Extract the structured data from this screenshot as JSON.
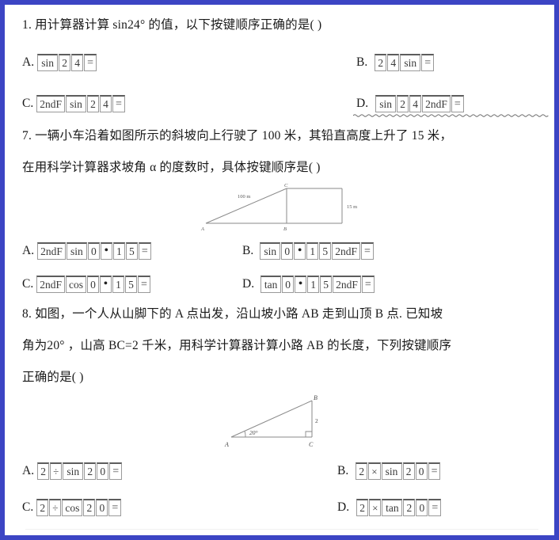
{
  "page": {
    "border_color": "#3c45c4",
    "background": "#ffffff",
    "text_color": "#1a1a1a",
    "key_border_color": "#9a9a9a"
  },
  "questions": [
    {
      "id": "q1",
      "number": "1.",
      "lines": [
        "1. 用计算器计算 sin24° 的值，以下按键顺序正确的是(      )"
      ],
      "options": [
        {
          "label": "A.",
          "keys": [
            "sin",
            "2",
            "4",
            "="
          ],
          "underlined": false
        },
        {
          "label": "B.",
          "keys": [
            "2",
            "4",
            "sin",
            "="
          ],
          "underlined": false
        },
        {
          "label": "C.",
          "keys": [
            "2ndF",
            "sin",
            "2",
            "4",
            "="
          ],
          "underlined": false
        },
        {
          "label": "D.",
          "keys": [
            "sin",
            "2",
            "4",
            "2ndF",
            "="
          ],
          "underlined": true
        }
      ]
    },
    {
      "id": "q7",
      "number": "7.",
      "lines": [
        "7. 一辆小车沿着如图所示的斜坡向上行驶了 100 米，其铅直高度上升了 15 米，",
        "在用科学计算器求坡角 α 的度数时，具体按键顺序是(          )"
      ],
      "figure": {
        "name": "slope-triangle-diagram",
        "labels": {
          "hypotenuse": "100 m",
          "vertical": "15 m",
          "vertex_a": "A",
          "vertex_b": "B",
          "vertex_c": "C"
        }
      },
      "options": [
        {
          "label": "A.",
          "keys": [
            "2ndF",
            "sin",
            "0",
            "•",
            "1",
            "5",
            "="
          ],
          "underlined": false
        },
        {
          "label": "B.",
          "keys": [
            "sin",
            "0",
            "•",
            "1",
            "5",
            "2ndF",
            "="
          ],
          "underlined": false
        },
        {
          "label": "C.",
          "keys": [
            "2ndF",
            "cos",
            "0",
            "•",
            "1",
            "5",
            "="
          ],
          "underlined": false
        },
        {
          "label": "D.",
          "keys": [
            "tan",
            "0",
            "•",
            "1",
            "5",
            "2ndF",
            "="
          ],
          "underlined": false
        }
      ]
    },
    {
      "id": "q8",
      "number": "8.",
      "lines": [
        "8. 如图，一个人从山脚下的 A 点出发，沿山坡小路 AB 走到山顶 B 点. 已知坡",
        "角为20° ，山高 BC=2 千米，用科学计算器计算小路 AB 的长度，下列按键顺序",
        "正确的是(      )"
      ],
      "figure": {
        "name": "mountain-triangle-diagram",
        "labels": {
          "angle": "20°",
          "side_bc": "2",
          "vertex_a": "A",
          "vertex_b": "B",
          "vertex_c": "C"
        }
      },
      "options": [
        {
          "label": "A.",
          "keys": [
            "2",
            "÷",
            "sin",
            "2",
            "0",
            "="
          ],
          "underlined": false
        },
        {
          "label": "B.",
          "keys": [
            "2",
            "×",
            "sin",
            "2",
            "0",
            "="
          ],
          "underlined": false
        },
        {
          "label": "C.",
          "keys": [
            "2",
            "÷",
            "cos",
            "2",
            "0",
            "="
          ],
          "underlined": false
        },
        {
          "label": "D.",
          "keys": [
            "2",
            "×",
            "tan",
            "2",
            "0",
            "="
          ],
          "underlined": false
        }
      ]
    }
  ]
}
